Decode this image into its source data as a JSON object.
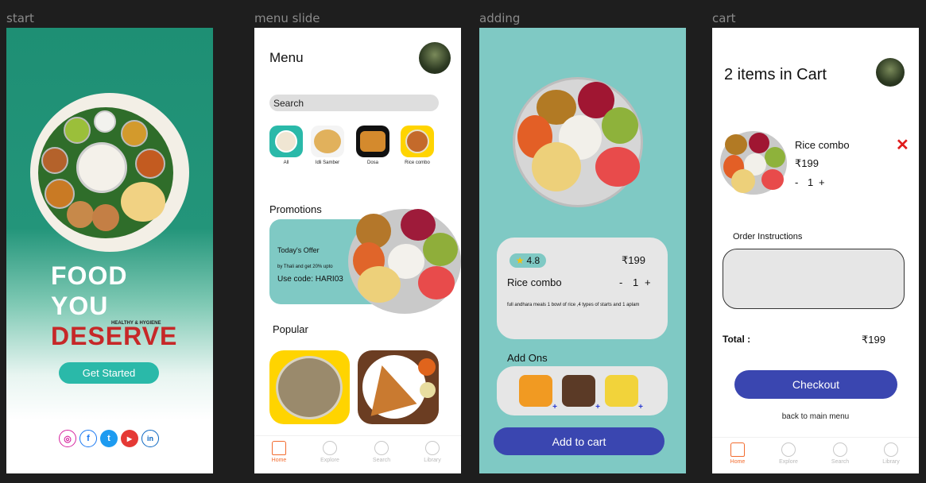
{
  "frames": {
    "start": "start",
    "menu": "menu slide",
    "adding": "adding",
    "cart": "cart"
  },
  "start": {
    "line1": "FOOD",
    "line2": "YOU",
    "line3": "DESERVE",
    "tagline": "HEALTHY & HYGIENE",
    "cta": "Get Started",
    "socials": [
      "instagram",
      "facebook",
      "twitter",
      "youtube",
      "linkedin"
    ],
    "social_glyphs": [
      "◎",
      "f",
      "t",
      "▶",
      "in"
    ],
    "colors": {
      "accent": "#2ab9a9",
      "deserve": "#c62828"
    }
  },
  "menu": {
    "title": "Menu",
    "search_placeholder": "Search",
    "categories": [
      {
        "label": "All",
        "icon": "all-food-icon"
      },
      {
        "label": "Idli Samber",
        "icon": "idli-icon"
      },
      {
        "label": "Dosa",
        "icon": "dosa-icon"
      },
      {
        "label": "Rice combo",
        "icon": "rice-combo-icon"
      }
    ],
    "promotions_heading": "Promotions",
    "offer_title": "Today's Offer",
    "offer_desc": "by Thali and get 20% upto",
    "offer_code": "Use code: HARI03",
    "popular_heading": "Popular",
    "nav": [
      "Home",
      "Explore",
      "Search",
      "Library"
    ]
  },
  "adding": {
    "rating": "4.8",
    "price": "₹199",
    "name": "Rice combo",
    "minus": "-",
    "qty": "1",
    "plus": "+",
    "description": "full andhara meals 1 bowl of rice ,4 types of starts and 1 aplam",
    "addons_heading": "Add Ons",
    "addon_plus": "+",
    "add_to_cart": "Add to cart"
  },
  "cart": {
    "title": "2 items in Cart",
    "item_name": "Rice combo",
    "item_price": "₹199",
    "minus": "-",
    "qty": "1",
    "plus": "+",
    "remove": "✕",
    "instructions_label": "Order Instructions",
    "instructions_value": "",
    "total_label": "Total :",
    "total_value": "₹199",
    "checkout": "Checkout",
    "back": "back to main menu",
    "nav": [
      "Home",
      "Explore",
      "Search",
      "Library"
    ]
  }
}
